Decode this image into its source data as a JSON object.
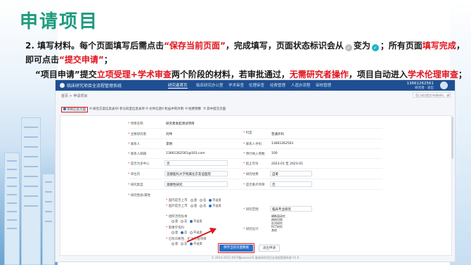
{
  "title": "申请项目",
  "instructions": {
    "line1_prefix": "2. 填写材料。每个页面填写后需点击",
    "line1_save": "“保存当前页面”",
    "line1_mid": "，完成填写，页面状态标识会从",
    "line1_mid2": "变为",
    "line1_mid3": "；所有页面",
    "line1_done": "填写完成",
    "line1_end": "，",
    "line2_prefix": "即可点击",
    "line2_submit": "“提交申请”",
    "line2_end": "；",
    "line3_prefix": "“项目申请”提交",
    "line3_stage": "立项受理+学术审查",
    "line3_mid": "两个阶段的材料，若审批通过，",
    "line3_noop": "无需研究者操作",
    "line3_mid2": "，项目自动进入",
    "line3_ethics": "学术伦理审查",
    "line3_end": "；"
  },
  "colors": {
    "title": "#1e9a7f",
    "highlight": "#e0141e",
    "nav_bar": "#1f4f92",
    "status_pending": "#bdbdbd",
    "status_done": "#18b3c7"
  },
  "app": {
    "system_name": "临床研究项目全流程管理系统",
    "nav": [
      "研究者首页",
      "临床研究办公室",
      "学术审查",
      "伦理审查",
      "经费管理",
      "人遗办流程",
      "审核管理"
    ],
    "active_nav": "研究者首页",
    "user_name": "13661262561",
    "user_role": "研究者 · 退出",
    "breadcrumb": "首页 > 申请项目",
    "alert": "您已成功提交申请材料，请等待审核",
    "steps": [
      "项目信息页面",
      "研究方案信息表单",
      "参与科室信息表单",
      "文件信息",
      "利益冲突声明",
      "经费预算",
      "其中提交页面"
    ],
    "form_left": [
      {
        "label": "项目名称",
        "value": "研究者发起测试项目"
      },
      {
        "label": "主要研究者",
        "value": "刘伟"
      },
      {
        "label": "联系人",
        "value": "李明"
      },
      {
        "label": "联系人邮箱",
        "value": "13661262561@163.com"
      },
      {
        "label": "是否为多中心",
        "value": "否"
      },
      {
        "label": "单位内",
        "value": "首都医科大学附属北京友谊医院"
      },
      {
        "label": "研究类型",
        "value": "观察性研究"
      },
      {
        "label": "研究性质/属性",
        "value": ""
      }
    ],
    "form_right": [
      {
        "label": "科室",
        "value": "普通外科"
      },
      {
        "label": "联系人手机",
        "value": "13661262561"
      },
      {
        "label": "预计纳入例数",
        "value": "100"
      },
      {
        "label": "起止年份",
        "value": "2023-01    至    2023-01"
      },
      {
        "label": "研究经费",
        "value": "自筹"
      },
      {
        "label": "是否重点项目",
        "value": "否"
      }
    ],
    "radio_rows": [
      {
        "label": "国内是否上市",
        "options": [
          "是",
          "否",
          "不适用"
        ],
        "selected": 2
      },
      {
        "label": "国外是否上市",
        "options": [
          "是",
          "否",
          "不适用"
        ],
        "selected": 2
      },
      {
        "label": "组织活检标本",
        "options": [
          "是",
          "否",
          "不适用"
        ],
        "selected": 2
      },
      {
        "label": "影像学资料",
        "options": [
          "是",
          "否",
          "不适用"
        ],
        "selected": 1
      },
      {
        "label": "已有诊断性、扩大检查项目",
        "options": [
          "是",
          "否",
          "不适用"
        ],
        "selected": 2
      }
    ],
    "research_field_label": "研究范围",
    "research_field_value": "临床专业研究",
    "design_label": "研究设计",
    "design_options": [
      "横断面研究",
      "病例对照",
      "队列研究",
      "RCT研究",
      "其他"
    ],
    "save_button": "保存当前页面数据",
    "cancel_button": "退出申请",
    "footer": "© 2014-2023 京ICP备xxxxxx号 临床研究项目全流程管理系统 V1.0"
  }
}
